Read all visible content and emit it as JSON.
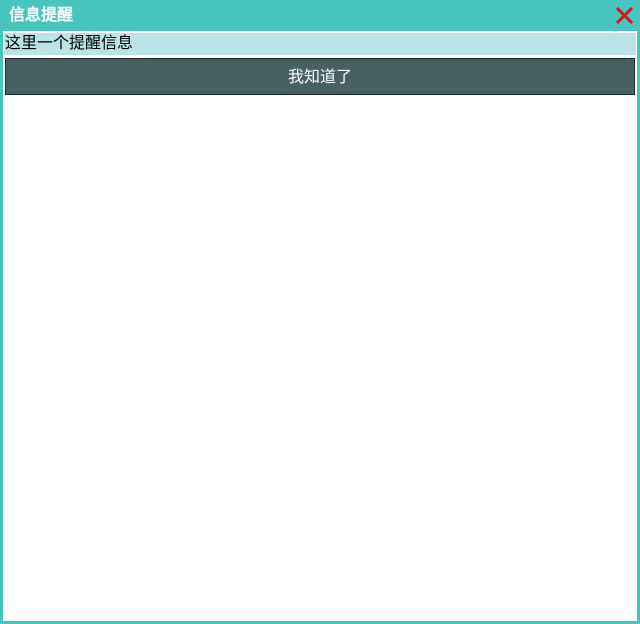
{
  "dialog": {
    "title": "信息提醒",
    "close_icon": "close-x-icon",
    "message": "这里一个提醒信息",
    "confirm_label": "我知道了"
  },
  "colors": {
    "title_bar": "#49c5c0",
    "message_background": "#b9e3e6",
    "button_background": "#466064",
    "close_icon": "#e0101a"
  }
}
